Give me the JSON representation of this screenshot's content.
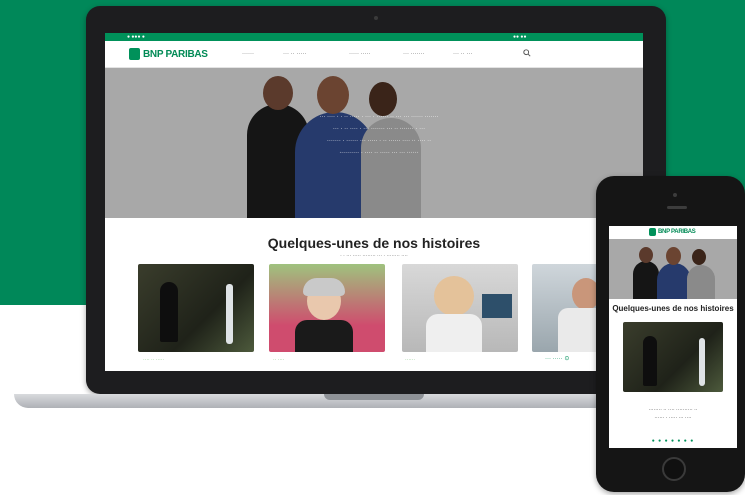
{
  "laptop": {
    "topstrip": {
      "left": "● ●●● ●",
      "right": "●● ●●"
    },
    "logo": "BNP PARIBAS",
    "nav": [
      {
        "label": "······"
      },
      {
        "label": "··· ·· ·····"
      },
      {
        "label": "·····  ·····"
      },
      {
        "label": "··· ·······"
      },
      {
        "label": "··· ·· ···"
      }
    ],
    "hero_text": [
      "··· ···· · · ·· ····· · ··· · ······ ·· ··· ··· ······ ·······",
      "··· · ·· ···· · ··· ······· ··· ·· ······· · ···",
      "······· · ······ ··· ····· · ·· ······ ···· ·· ···· ··",
      "·········· · ···· ·· ····· ··· ··· ······"
    ],
    "section_title": "Quelques-unes de nos histoires",
    "section_subtitle": "· · ··· ····· ········ ··· · ········ ····",
    "cards": [
      {
        "caption": "···· ·· ·····"
      },
      {
        "caption": "·· ····"
      },
      {
        "caption": "······"
      },
      {
        "caption": ""
      }
    ],
    "next_label": "··· ····· ⊙"
  },
  "phone": {
    "logo": "BNP PARIBAS",
    "title": "Quelques-unes de nos histoires",
    "caption_lines": [
      "········ ·· ···· ·········· ··",
      "······ · ····· ··· ····"
    ],
    "dots": "● ● ● ● ● ● ●"
  },
  "colors": {
    "brand_green": "#008859",
    "accent_green": "#00915a"
  }
}
